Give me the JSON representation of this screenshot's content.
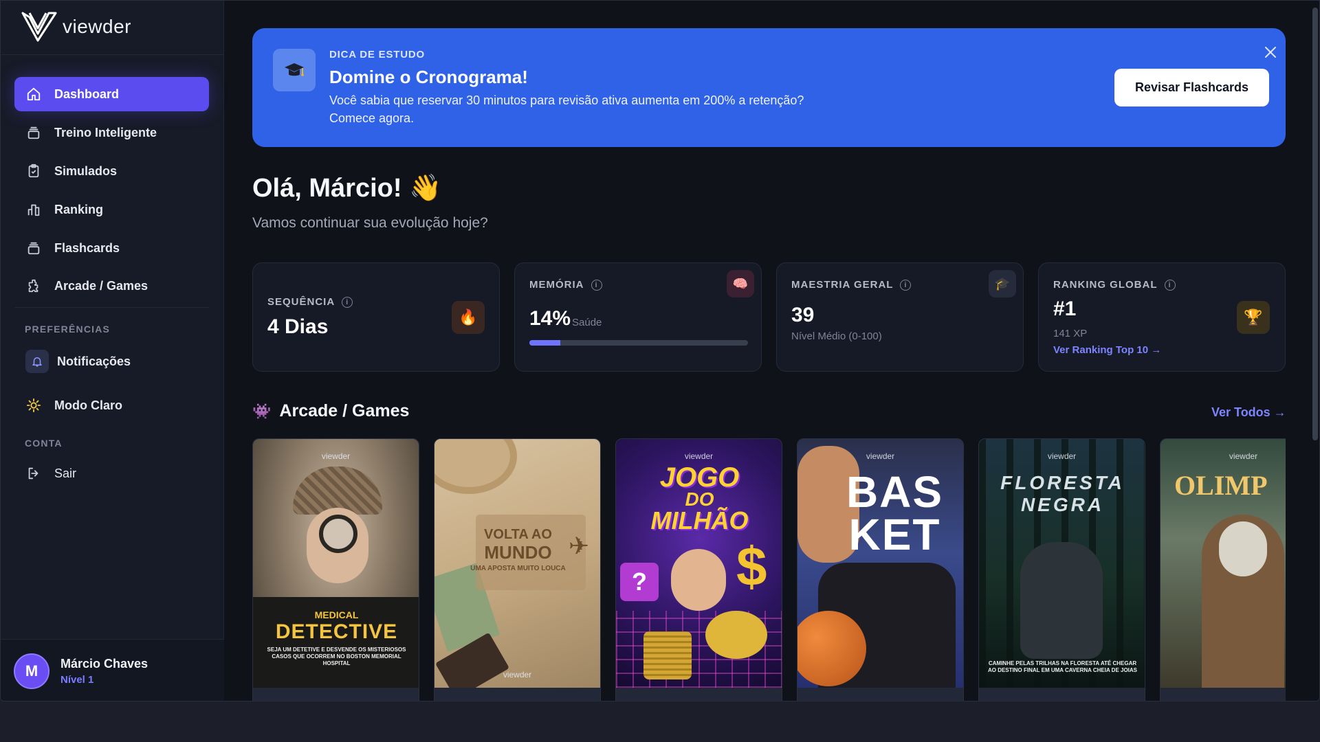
{
  "app": {
    "logo_text": "viewder"
  },
  "sidebar": {
    "nav": [
      {
        "label": "Dashboard",
        "icon": "home-icon"
      },
      {
        "label": "Treino Inteligente",
        "icon": "stack-icon"
      },
      {
        "label": "Simulados",
        "icon": "clipboard-icon"
      },
      {
        "label": "Ranking",
        "icon": "bar-chart-icon"
      },
      {
        "label": "Flashcards",
        "icon": "stack-icon"
      },
      {
        "label": "Arcade / Games",
        "icon": "puzzle-icon"
      }
    ],
    "preferences_heading": "PREFERÊNCIAS",
    "notifications_label": "Notificações",
    "theme_label": "Modo Claro",
    "account_heading": "CONTA",
    "logout_label": "Sair",
    "user": {
      "initial": "M",
      "name": "Márcio Chaves",
      "level": "Nível 1"
    }
  },
  "banner": {
    "kicker": "DICA DE ESTUDO",
    "title": "Domine o Cronograma!",
    "text": "Você sabia que reservar 30 minutos para revisão ativa aumenta em 200% a retenção? Comece agora.",
    "button": "Revisar Flashcards"
  },
  "greeting": {
    "title": "Olá, Márcio! 👋",
    "subtitle": "Vamos continuar sua evolução hoje?"
  },
  "stats": {
    "streak": {
      "label": "SEQUÊNCIA",
      "value": "4 Dias",
      "icon": "🔥"
    },
    "memory": {
      "label": "MEMÓRIA",
      "value": "14%",
      "sub": "Saúde",
      "progress": 0.14,
      "icon": "🧠"
    },
    "mastery": {
      "label": "MAESTRIA GERAL",
      "value": "39",
      "sub": "Nível Médio (0-100)",
      "icon": "🎓"
    },
    "ranking": {
      "label": "RANKING GLOBAL",
      "value": "#1",
      "sub": "141 XP",
      "link": "Ver Ranking Top 10 →",
      "icon": "🏆"
    }
  },
  "arcade": {
    "title": "Arcade / Games",
    "see_all": "Ver Todos →",
    "brand": "viewder",
    "games": [
      {
        "title_top": "MEDICAL",
        "title_main": "DETECTIVE",
        "tagline": "SEJA UM DETETIVE E DESVENDE OS MISTERIOSOS CASOS QUE OCORREM NO BOSTON MEMORIAL HOSPITAL"
      },
      {
        "title_top": "VOLTA AO",
        "title_main": "MUNDO",
        "tagline": "UMA APOSTA MUITO LOUCA"
      },
      {
        "title_top": "JOGO",
        "title_mid": "DO",
        "title_main": "MILHÃO"
      },
      {
        "title_top": "BAS",
        "title_main": "KET"
      },
      {
        "title_top": "FLORESTA",
        "title_main": "NEGRA",
        "tagline": "CAMINHE PELAS TRILHAS NA FLORESTA ATÉ CHEGAR AO DESTINO FINAL EM UMA CAVERNA CHEIA DE JOIAS"
      },
      {
        "title_main": "OLIMP"
      }
    ]
  },
  "colors": {
    "accent": "#5b4cf0",
    "banner": "#2f62e6",
    "link": "#7d84ff"
  }
}
